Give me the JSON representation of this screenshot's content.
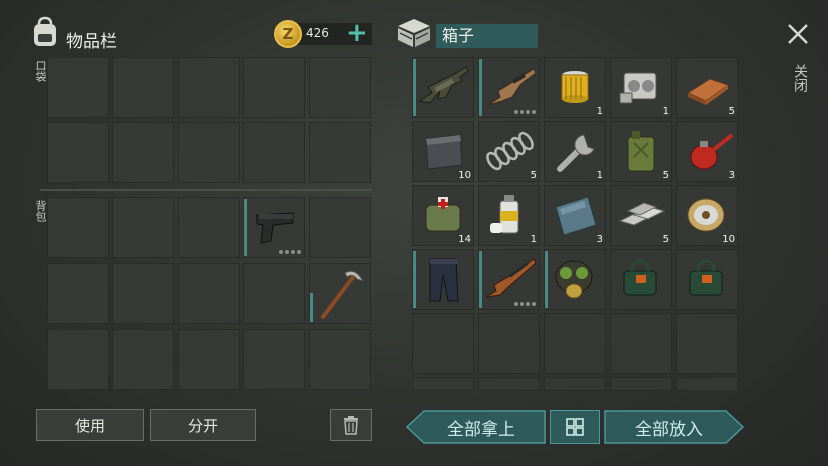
{
  "inventory": {
    "title": "物品栏",
    "coins": "426",
    "pocket_label": "口袋",
    "backpack_label": "背包",
    "use_label": "使用",
    "split_label": "分开"
  },
  "box": {
    "title": "箱子",
    "take_all_label": "全部拿上",
    "put_all_label": "全部放入",
    "close_label": "关闭",
    "items": [
      {
        "name": "assault-rifle",
        "count": ""
      },
      {
        "name": "rifle-tan",
        "count": ""
      },
      {
        "name": "oil-filter",
        "count": "1"
      },
      {
        "name": "engine-part",
        "count": "1"
      },
      {
        "name": "copper-ingot",
        "count": "5"
      },
      {
        "name": "metal-plate",
        "count": "10"
      },
      {
        "name": "spring",
        "count": "5"
      },
      {
        "name": "wrench",
        "count": "1"
      },
      {
        "name": "jerrycan",
        "count": "5"
      },
      {
        "name": "oil-can",
        "count": "3"
      },
      {
        "name": "first-aid-bag",
        "count": "14"
      },
      {
        "name": "spray-can",
        "count": "1"
      },
      {
        "name": "glass-sheet",
        "count": "3"
      },
      {
        "name": "iron-bars",
        "count": "5"
      },
      {
        "name": "wire-spool",
        "count": "10"
      },
      {
        "name": "pants",
        "count": ""
      },
      {
        "name": "hunting-rifle",
        "count": ""
      },
      {
        "name": "gas-mask",
        "count": ""
      },
      {
        "name": "explosive-bag",
        "count": ""
      },
      {
        "name": "explosive-bag",
        "count": ""
      }
    ]
  },
  "backpack_items": [
    {
      "name": "pistol",
      "count": ""
    },
    {
      "name": "pickaxe",
      "count": ""
    }
  ]
}
